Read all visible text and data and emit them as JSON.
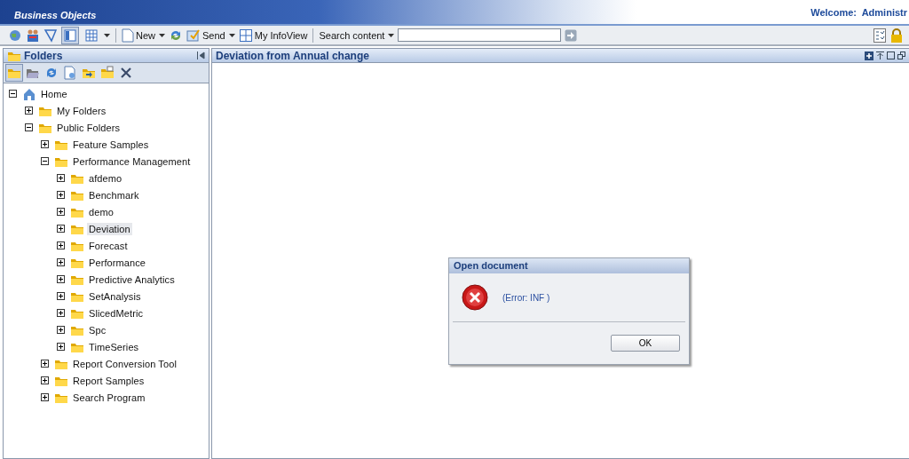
{
  "header": {
    "logo": "Business Objects",
    "welcome": "Welcome:  Administr"
  },
  "toolbar": {
    "view_buttons": [
      {
        "selected": true
      },
      {
        "selected": false
      }
    ],
    "new_label": "New",
    "send_label": "Send",
    "infoview_label": "My InfoView",
    "search_label": "Search content"
  },
  "folders_panel": {
    "title": "Folders",
    "tools": [
      {
        "selected": true
      },
      {
        "selected": false
      },
      {
        "selected": false
      },
      {
        "selected": false
      },
      {
        "selected": false
      },
      {
        "selected": false
      },
      {
        "selected": false
      }
    ],
    "tree": [
      {
        "label": "Home",
        "kind": "home",
        "expanded": true,
        "selected": false,
        "children": [
          {
            "label": "My Folders",
            "kind": "folder",
            "expanded": false,
            "selected": false
          },
          {
            "label": "Public Folders",
            "kind": "folder",
            "expanded": true,
            "selected": false,
            "children": [
              {
                "label": "Feature Samples",
                "kind": "folder",
                "expanded": false,
                "selected": false
              },
              {
                "label": "Performance Management",
                "kind": "folder",
                "expanded": true,
                "selected": false,
                "children": [
                  {
                    "label": "afdemo",
                    "kind": "folder",
                    "expanded": false,
                    "selected": false
                  },
                  {
                    "label": "Benchmark",
                    "kind": "folder",
                    "expanded": false,
                    "selected": false
                  },
                  {
                    "label": "demo",
                    "kind": "folder",
                    "expanded": false,
                    "selected": false
                  },
                  {
                    "label": "Deviation",
                    "kind": "folder",
                    "expanded": false,
                    "selected": true
                  },
                  {
                    "label": "Forecast",
                    "kind": "folder",
                    "expanded": false,
                    "selected": false
                  },
                  {
                    "label": "Performance",
                    "kind": "folder",
                    "expanded": false,
                    "selected": false
                  },
                  {
                    "label": "Predictive Analytics",
                    "kind": "folder",
                    "expanded": false,
                    "selected": false
                  },
                  {
                    "label": "SetAnalysis",
                    "kind": "folder",
                    "expanded": false,
                    "selected": false
                  },
                  {
                    "label": "SlicedMetric",
                    "kind": "folder",
                    "expanded": false,
                    "selected": false
                  },
                  {
                    "label": "Spc",
                    "kind": "folder",
                    "expanded": false,
                    "selected": false
                  },
                  {
                    "label": "TimeSeries",
                    "kind": "folder",
                    "expanded": false,
                    "selected": false
                  }
                ]
              },
              {
                "label": "Report Conversion Tool",
                "kind": "folder",
                "expanded": false,
                "selected": false
              },
              {
                "label": "Report Samples",
                "kind": "folder",
                "expanded": false,
                "selected": false
              },
              {
                "label": "Search Program",
                "kind": "folder",
                "expanded": false,
                "selected": false
              }
            ]
          }
        ]
      }
    ]
  },
  "content_panel": {
    "title": "Deviation from Annual change"
  },
  "dialog": {
    "title": "Open document",
    "message": "(Error: INF )",
    "buttons": [
      "OK"
    ]
  }
}
